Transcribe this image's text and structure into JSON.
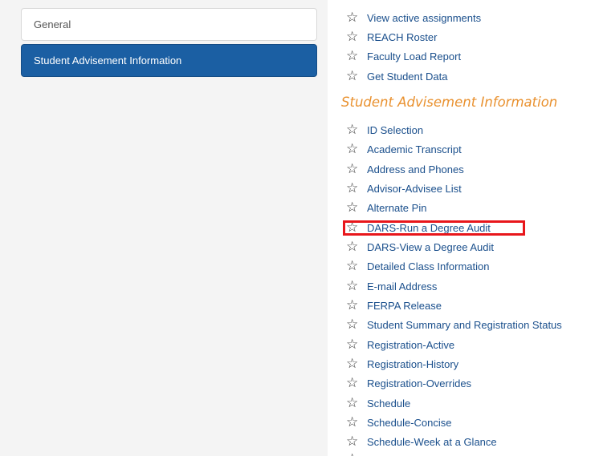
{
  "sidebar": {
    "items": [
      {
        "label": "General",
        "active": false
      },
      {
        "label": "Student Advisement Information",
        "active": true
      }
    ]
  },
  "main": {
    "top_links": [
      "View active assignments",
      "REACH Roster",
      "Faculty Load Report",
      "Get Student Data"
    ],
    "section_title": "Student Advisement Information",
    "section_links": [
      "ID Selection",
      "Academic Transcript",
      "Address and Phones",
      "Advisor-Advisee List",
      "Alternate Pin",
      "DARS-Run a Degree Audit",
      "DARS-View a Degree Audit",
      "Detailed Class Information",
      "E-mail Address",
      "FERPA Release",
      "Student Summary and Registration Status",
      "Registration-Active",
      "Registration-History",
      "Registration-Overrides",
      "Schedule",
      "Schedule-Concise",
      "Schedule-Week at a Glance"
    ],
    "highlighted_item": "DARS-Run a Degree Audit"
  },
  "icons": {
    "favorite": "star-outline-icon"
  },
  "colors": {
    "active_nav_bg": "#1b5fa3",
    "link": "#1a4f8c",
    "section_heading": "#e9912f",
    "highlight_border": "#e8161b"
  }
}
